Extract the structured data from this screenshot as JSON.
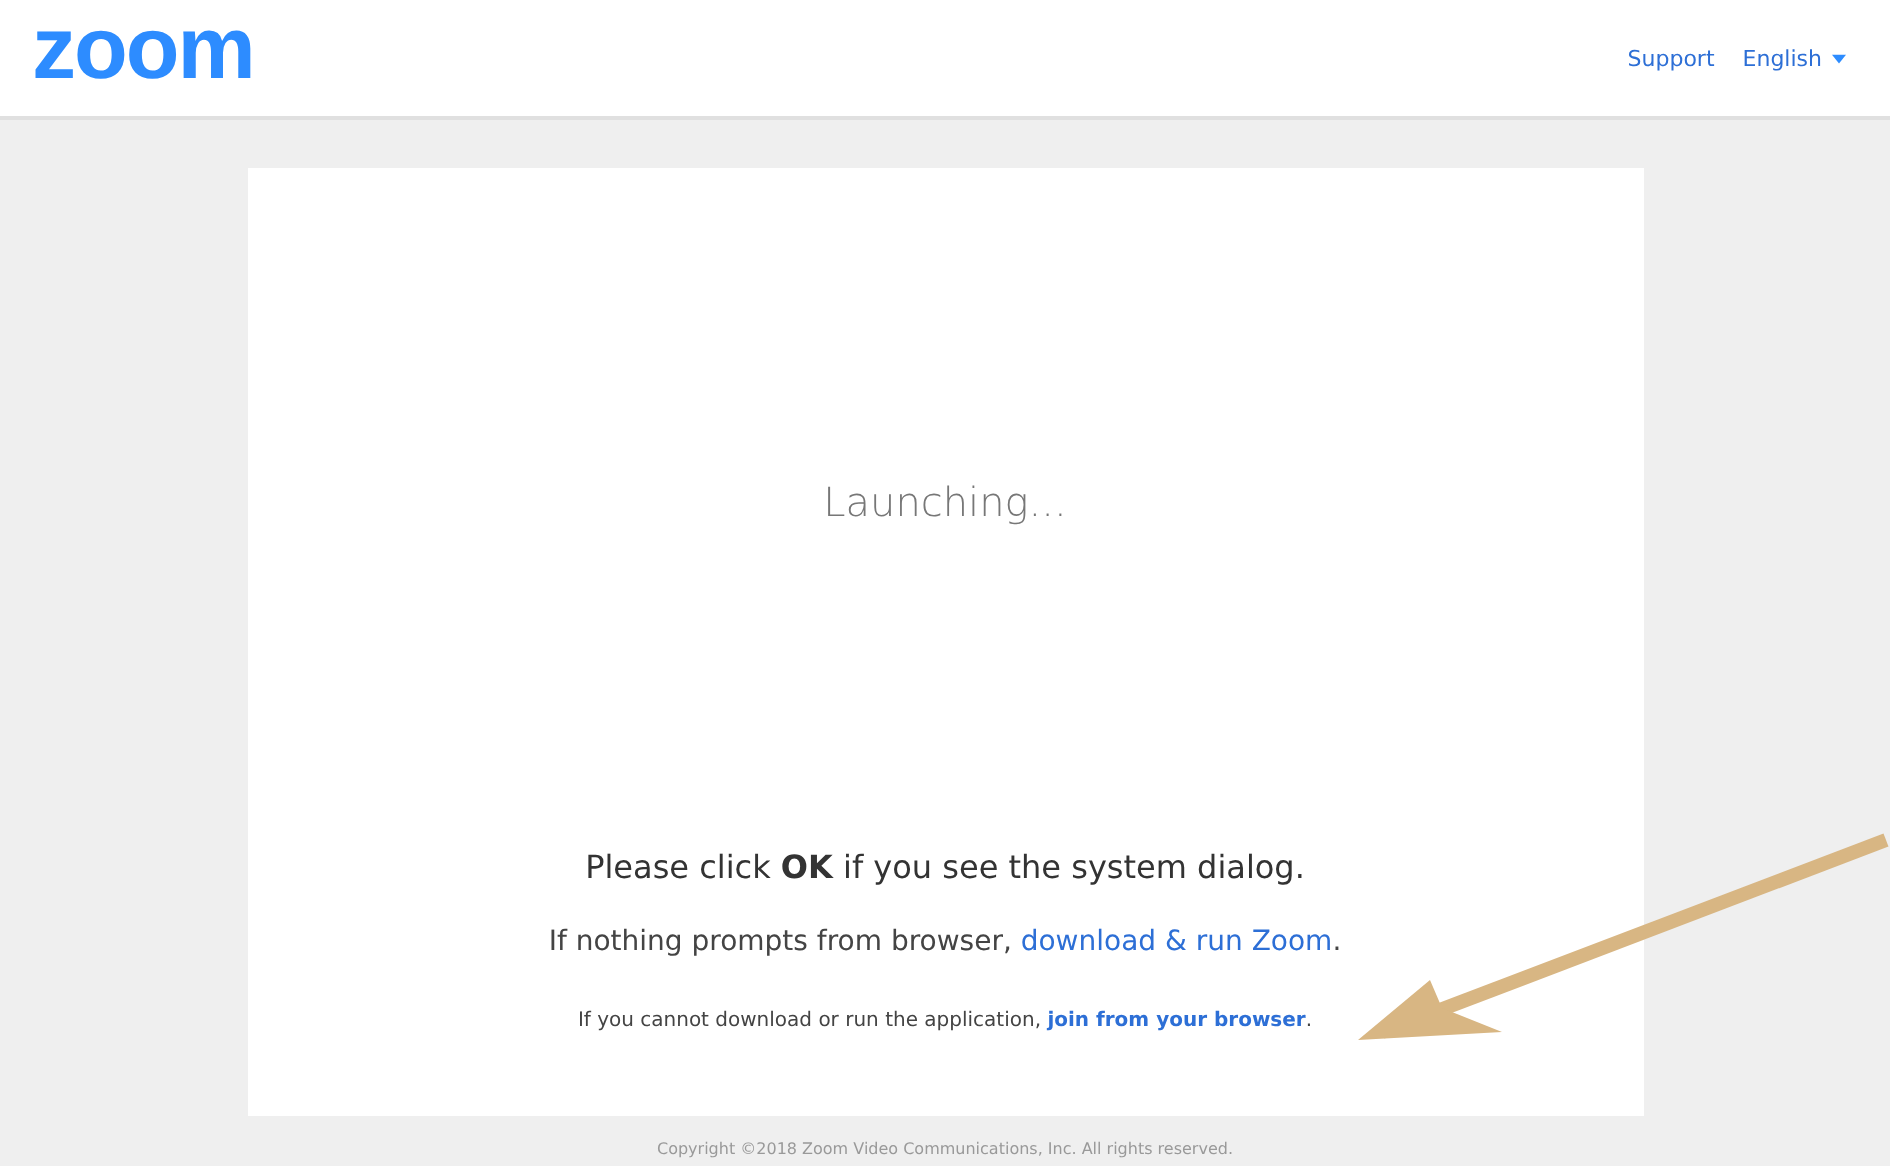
{
  "header": {
    "logo": "zoom",
    "links": [
      {
        "label": "Support",
        "kind": "link"
      },
      {
        "label": "English",
        "kind": "dropdown"
      }
    ]
  },
  "card": {
    "status": "Launching...",
    "instruction": "Please click **OK** if you see the system dialog.",
    "lines": [
      {
        "text": "If nothing prompts from browser, ",
        "link": "download & run Zoom",
        "end": ".",
        "kind": "regular"
      },
      {
        "text": "If you cannot download or run the application, ",
        "link": "join from your browser",
        "end": ".",
        "kind": "fineprint"
      }
    ]
  },
  "footer": {
    "copyright": "Copyright ©2018 Zoom Video Communications, Inc. All rights reserved."
  },
  "annotation": {
    "kind": "arrow"
  }
}
